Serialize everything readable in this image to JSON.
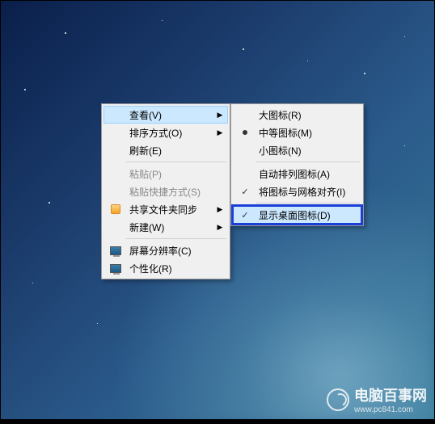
{
  "primary_menu": {
    "items": [
      {
        "label": "查看(V)",
        "hasSubmenu": true,
        "highlighted": true
      },
      {
        "label": "排序方式(O)",
        "hasSubmenu": true
      },
      {
        "label": "刷新(E)"
      }
    ],
    "items2": [
      {
        "label": "粘贴(P)",
        "disabled": true
      },
      {
        "label": "粘贴快捷方式(S)",
        "disabled": true
      },
      {
        "label": "共享文件夹同步",
        "hasSubmenu": true,
        "icon": "sync"
      },
      {
        "label": "新建(W)",
        "hasSubmenu": true
      }
    ],
    "items3": [
      {
        "label": "屏幕分辨率(C)",
        "icon": "monitor"
      },
      {
        "label": "个性化(R)",
        "icon": "monitor"
      }
    ]
  },
  "sub_menu": {
    "items": [
      {
        "label": "大图标(R)"
      },
      {
        "label": "中等图标(M)",
        "radio": true
      },
      {
        "label": "小图标(N)"
      }
    ],
    "items2": [
      {
        "label": "自动排列图标(A)"
      },
      {
        "label": "将图标与网格对齐(I)",
        "checked": true
      }
    ],
    "items3": [
      {
        "label": "显示桌面图标(D)",
        "checked": true,
        "highlighted": true,
        "boxed": true
      }
    ]
  },
  "watermark": {
    "title": "电脑百事网",
    "url": "www.pc841.com"
  }
}
